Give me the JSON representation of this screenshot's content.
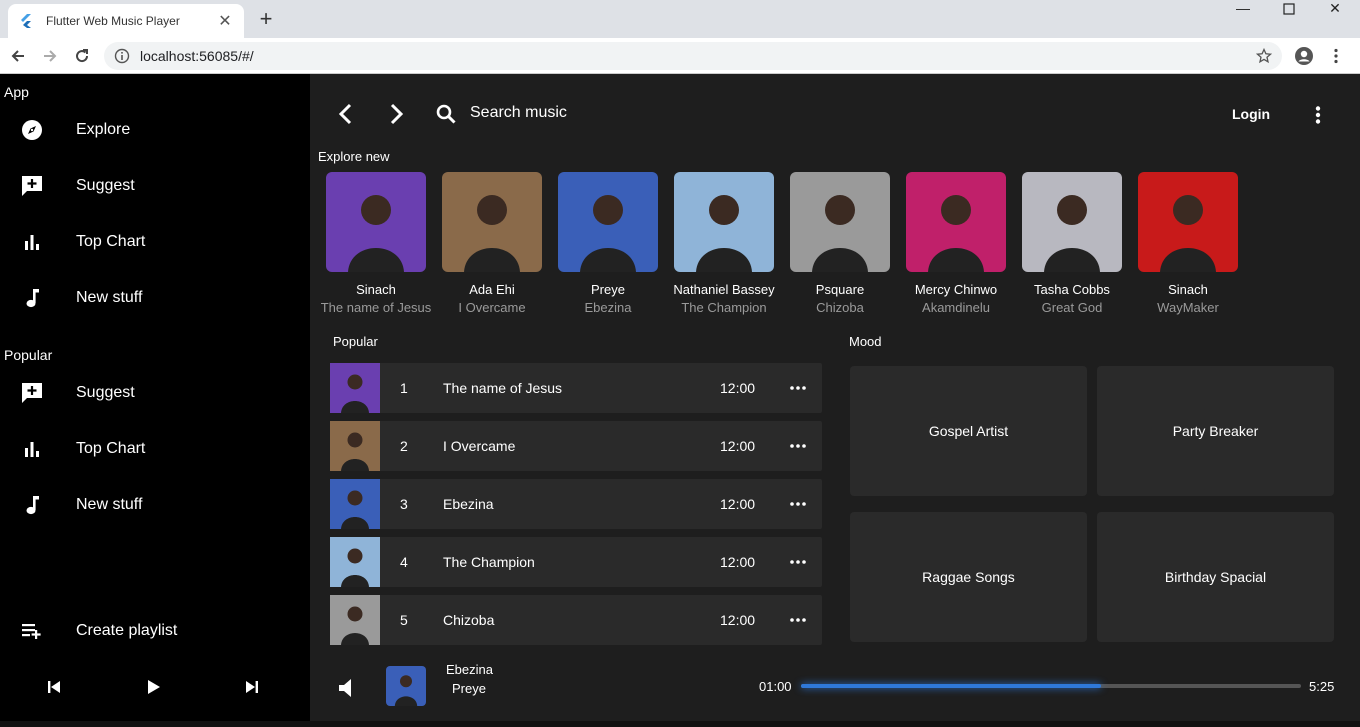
{
  "browser": {
    "tab_title": "Flutter Web Music Player",
    "url": "localhost:56085/#/"
  },
  "sidebar": {
    "sections": [
      {
        "label": "App",
        "items": [
          {
            "label": "Explore",
            "icon": "compass-icon"
          },
          {
            "label": "Suggest",
            "icon": "add-comment-icon"
          },
          {
            "label": "Top Chart",
            "icon": "bar-chart-icon"
          },
          {
            "label": "New stuff",
            "icon": "music-note-icon"
          }
        ]
      },
      {
        "label": "Popular",
        "items": [
          {
            "label": "Suggest",
            "icon": "add-comment-icon"
          },
          {
            "label": "Top Chart",
            "icon": "bar-chart-icon"
          },
          {
            "label": "New stuff",
            "icon": "music-note-icon"
          }
        ]
      }
    ],
    "create_playlist": "Create playlist"
  },
  "topbar": {
    "search_placeholder": "Search music",
    "login": "Login"
  },
  "explore": {
    "heading": "Explore new",
    "artists": [
      {
        "name": "Sinach",
        "song": "The name of Jesus",
        "color": "#6a3fb0"
      },
      {
        "name": "Ada Ehi",
        "song": "I Overcame",
        "color": "#8a6a4a"
      },
      {
        "name": "Preye",
        "song": "Ebezina",
        "color": "#3a5fb8"
      },
      {
        "name": "Nathaniel Bassey",
        "song": "The Champion",
        "color": "#8fb4d8"
      },
      {
        "name": "Psquare",
        "song": "Chizoba",
        "color": "#9a9a9a"
      },
      {
        "name": "Mercy Chinwo",
        "song": "Akamdinelu",
        "color": "#c0206a"
      },
      {
        "name": "Tasha Cobbs",
        "song": "Great God",
        "color": "#b8b8c0"
      },
      {
        "name": "Sinach",
        "song": "WayMaker",
        "color": "#c81a1a"
      }
    ]
  },
  "popular": {
    "heading": "Popular",
    "tracks": [
      {
        "num": "1",
        "title": "The name of Jesus",
        "time": "12:00",
        "color": "#6a3fb0"
      },
      {
        "num": "2",
        "title": "I Overcame",
        "time": "12:00",
        "color": "#8a6a4a"
      },
      {
        "num": "3",
        "title": "Ebezina",
        "time": "12:00",
        "color": "#3a5fb8"
      },
      {
        "num": "4",
        "title": "The Champion",
        "time": "12:00",
        "color": "#8fb4d8"
      },
      {
        "num": "5",
        "title": "Chizoba",
        "time": "12:00",
        "color": "#9a9a9a"
      }
    ]
  },
  "mood": {
    "heading": "Mood",
    "items": [
      "Gospel Artist",
      "Party Breaker",
      "Raggae Songs",
      "Birthday Spacial"
    ]
  },
  "now_playing": {
    "title": "Ebezina",
    "artist": "Preye",
    "current_time": "01:00",
    "total_time": "5:25",
    "progress": 0.6,
    "accent": "#2f78d8",
    "thumb_color": "#3a5fb8"
  }
}
